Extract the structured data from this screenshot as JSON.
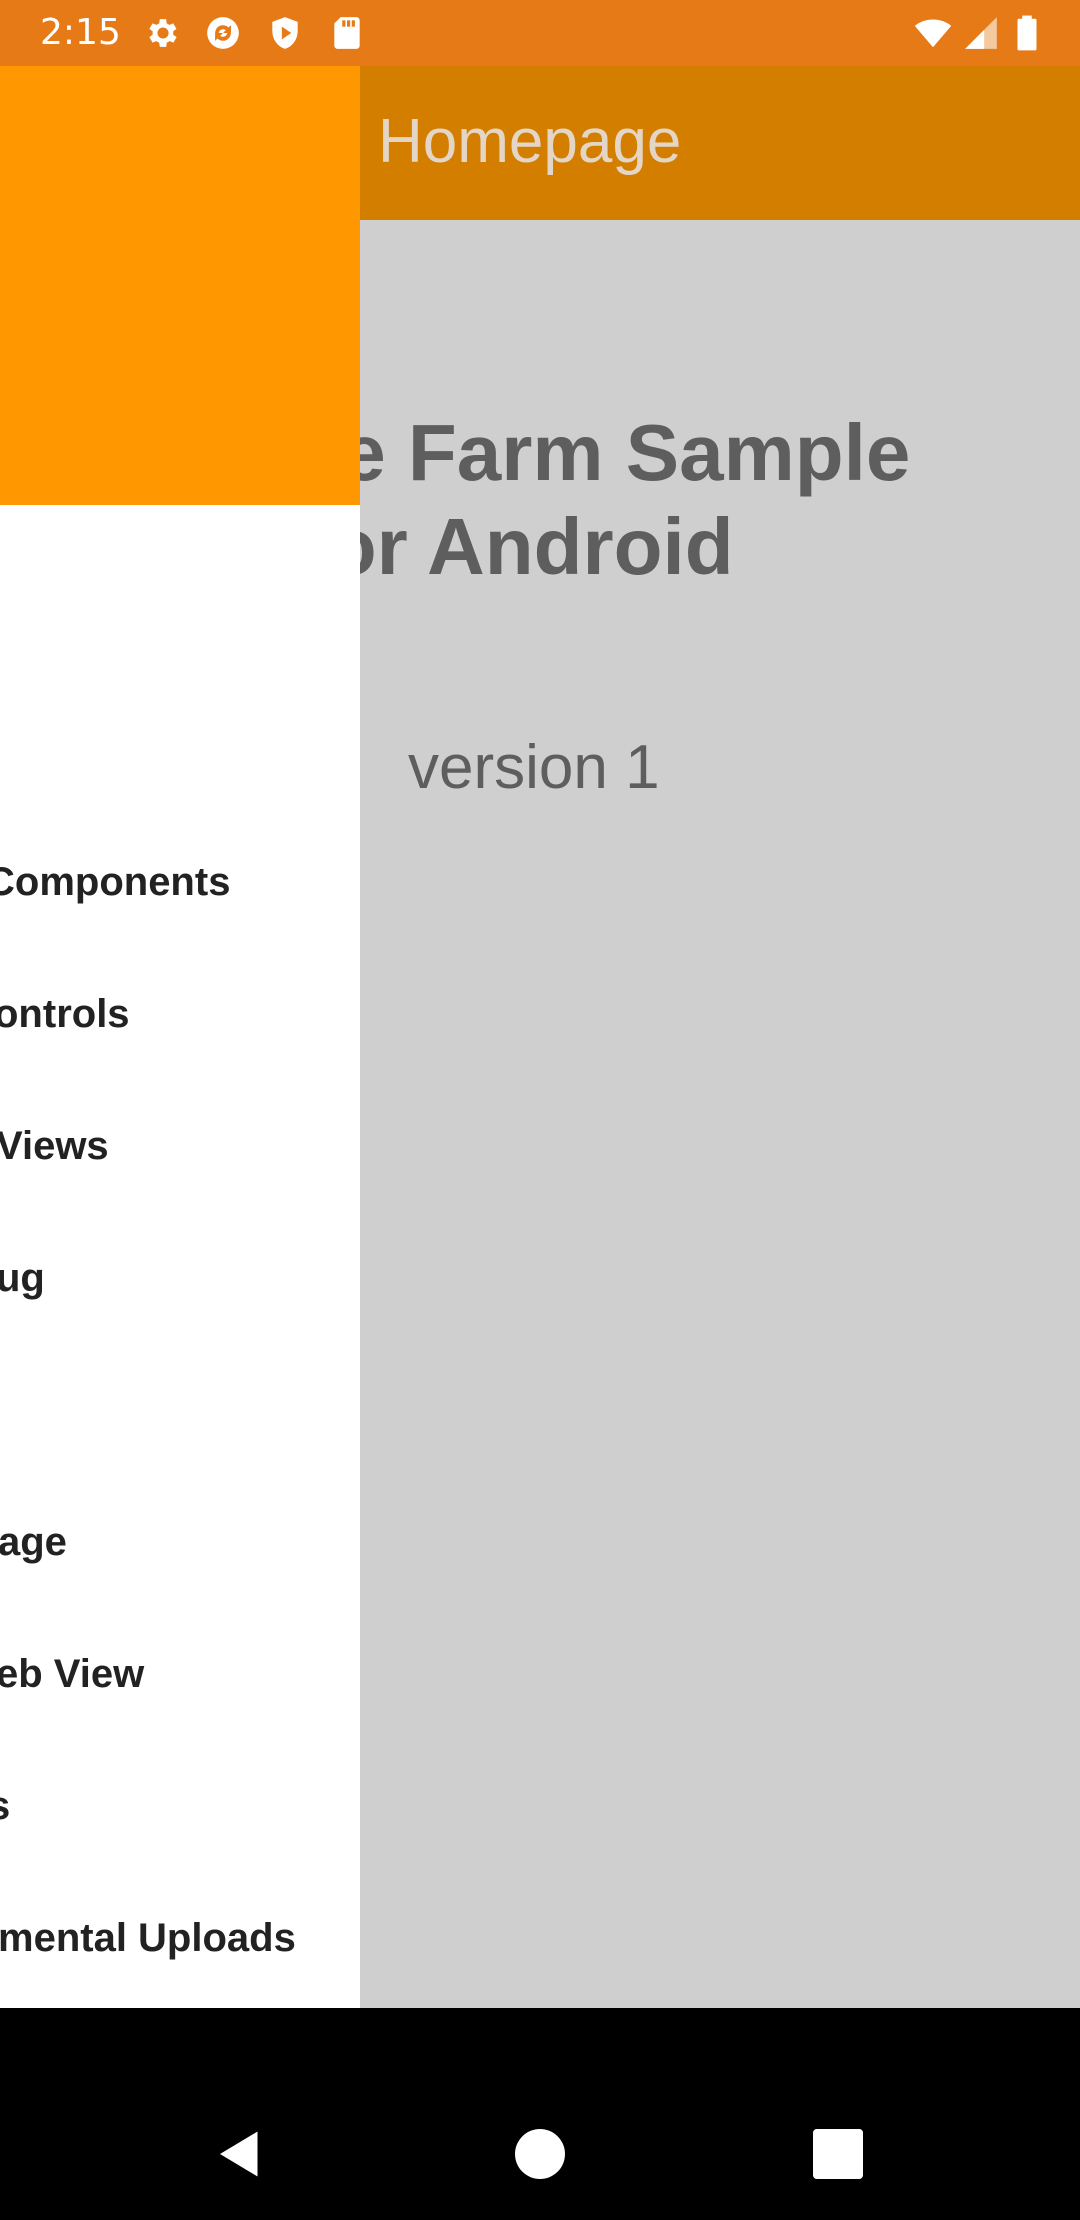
{
  "status_bar": {
    "time": "2:15",
    "icons": [
      "gear-icon",
      "sync-icon",
      "shield-play-icon",
      "sd-card-icon",
      "wifi-icon",
      "signal-icon",
      "battery-icon"
    ]
  },
  "app_bar": {
    "title": "Homepage"
  },
  "main": {
    "title_line1": "vice Farm Sample",
    "title_line2": "p for Android",
    "version": "version 1"
  },
  "drawer": {
    "items": [
      {
        "label": "Components"
      },
      {
        "label": "ontrols"
      },
      {
        "label": "Views"
      },
      {
        "label": "ug"
      },
      {
        "label": "age"
      },
      {
        "label": "eb View"
      },
      {
        "label": "s"
      },
      {
        "label": "mental Uploads"
      }
    ]
  },
  "nav_bar": {
    "buttons": [
      "back-icon",
      "home-icon",
      "recents-icon"
    ]
  },
  "colors": {
    "status_bar": "#E67A17",
    "app_bar": "#D47E00",
    "drawer_header": "#FF9800",
    "content_bg": "#CFCFCF"
  }
}
